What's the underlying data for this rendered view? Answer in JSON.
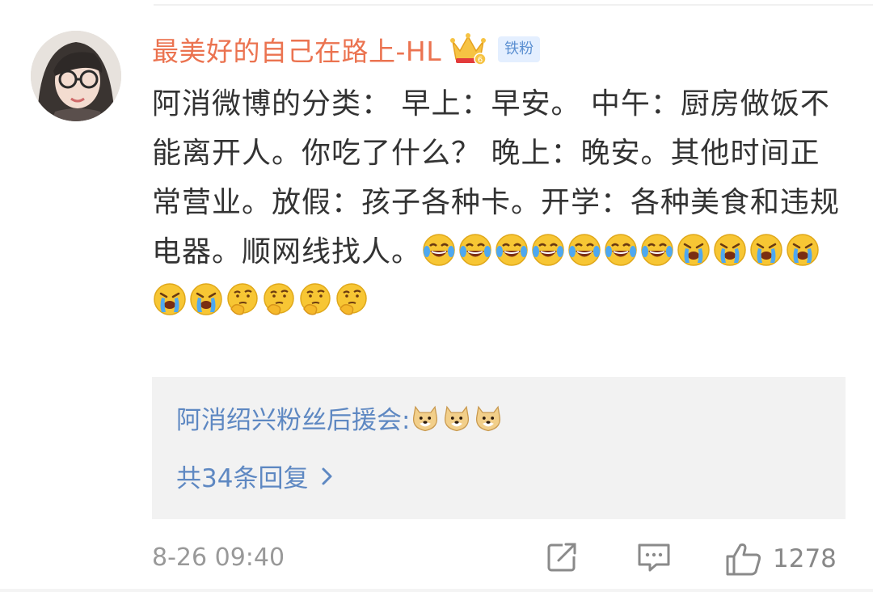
{
  "comment": {
    "username": "最美好的自己在路上-HL",
    "level_badge": "6",
    "fan_badge": "铁粉",
    "text": "阿消微博的分类： 早上：早安。 中午：厨房做饭不能离开人。你吃了什么？ 晚上：晚安。其他时间正常营业。放假：孩子各种卡。开学：各种美食和违规电器。顺网线找人。",
    "emoji_sequence": [
      "laugh-cry",
      "laugh-cry",
      "laugh-cry",
      "laugh-cry",
      "laugh-cry",
      "laugh-cry",
      "laugh-cry",
      "sob",
      "sob",
      "sob",
      "sob",
      "sob",
      "sob",
      "think",
      "think",
      "think",
      "think"
    ],
    "reply_preview": {
      "author": "阿消绍兴粉丝后援会:",
      "emoji_sequence": [
        "doge",
        "doge",
        "doge"
      ]
    },
    "reply_count_label": "共34条回复",
    "timestamp": "8-26 09:40",
    "like_count": "1278"
  },
  "icons": {
    "crown": "crown-icon",
    "chevron": "chevron-right-icon",
    "share": "share-icon",
    "comment": "comment-icon",
    "like": "thumbs-up-icon"
  },
  "colors": {
    "username": "#eb7350",
    "link": "#5e88c2",
    "text": "#333333",
    "meta": "#999999",
    "reply_bg": "#f2f2f2",
    "badge_bg": "#e4efff"
  }
}
